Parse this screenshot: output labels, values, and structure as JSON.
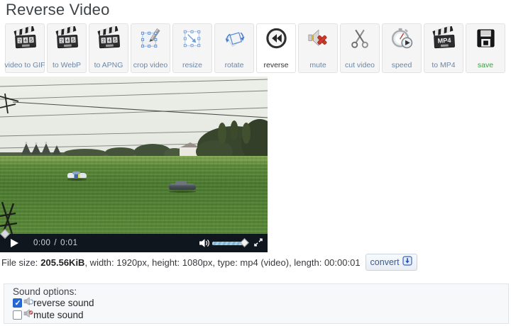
{
  "page": {
    "title": "Reverse Video"
  },
  "toolbar": {
    "clapper_digits": [
      "2",
      "4",
      "5"
    ],
    "items": [
      {
        "label": "video to GIF",
        "icon": "clapperboard-icon",
        "selected": false
      },
      {
        "label": "to WebP",
        "icon": "clapperboard-icon",
        "selected": false
      },
      {
        "label": "to APNG",
        "icon": "clapperboard-icon",
        "selected": false
      },
      {
        "label": "crop video",
        "icon": "crop-icon",
        "selected": false
      },
      {
        "label": "resize",
        "icon": "resize-icon",
        "selected": false
      },
      {
        "label": "rotate",
        "icon": "rotate-icon",
        "selected": false
      },
      {
        "label": "reverse",
        "icon": "rewind-icon",
        "selected": true
      },
      {
        "label": "mute",
        "icon": "muted-speaker-icon",
        "selected": false
      },
      {
        "label": "cut video",
        "icon": "scissors-icon",
        "selected": false
      },
      {
        "label": "speed",
        "icon": "stopwatch-icon",
        "selected": false
      },
      {
        "label": "to MP4",
        "icon": "clapperboard-mp4-icon",
        "icon_text": "MP4",
        "selected": false
      },
      {
        "label": "save",
        "icon": "floppy-disk-icon",
        "selected": false,
        "label_color": "#3fa03f"
      }
    ]
  },
  "player": {
    "current_time": "0:00",
    "separator": "/",
    "duration": "0:01"
  },
  "file_info": {
    "size_label": "File size:",
    "size_value": "205.56KiB",
    "details": ", width: 1920px, height: 1080px, type: mp4 (video), length: 00:00:01",
    "convert_label": "convert"
  },
  "sound_options": {
    "title": "Sound options:",
    "options": [
      {
        "label": "reverse sound",
        "checked": true
      },
      {
        "label": "mute sound",
        "checked": false
      }
    ]
  },
  "colors": {
    "toolbar_label_blue": "#6b87a5",
    "save_green": "#3fa03f",
    "convert_blue": "#3a5b8e",
    "checkbox_blue": "#2569d8",
    "player_bar": "#10161d",
    "volume_blue": "#7fb6d6",
    "mute_red": "#cf3a2d"
  }
}
